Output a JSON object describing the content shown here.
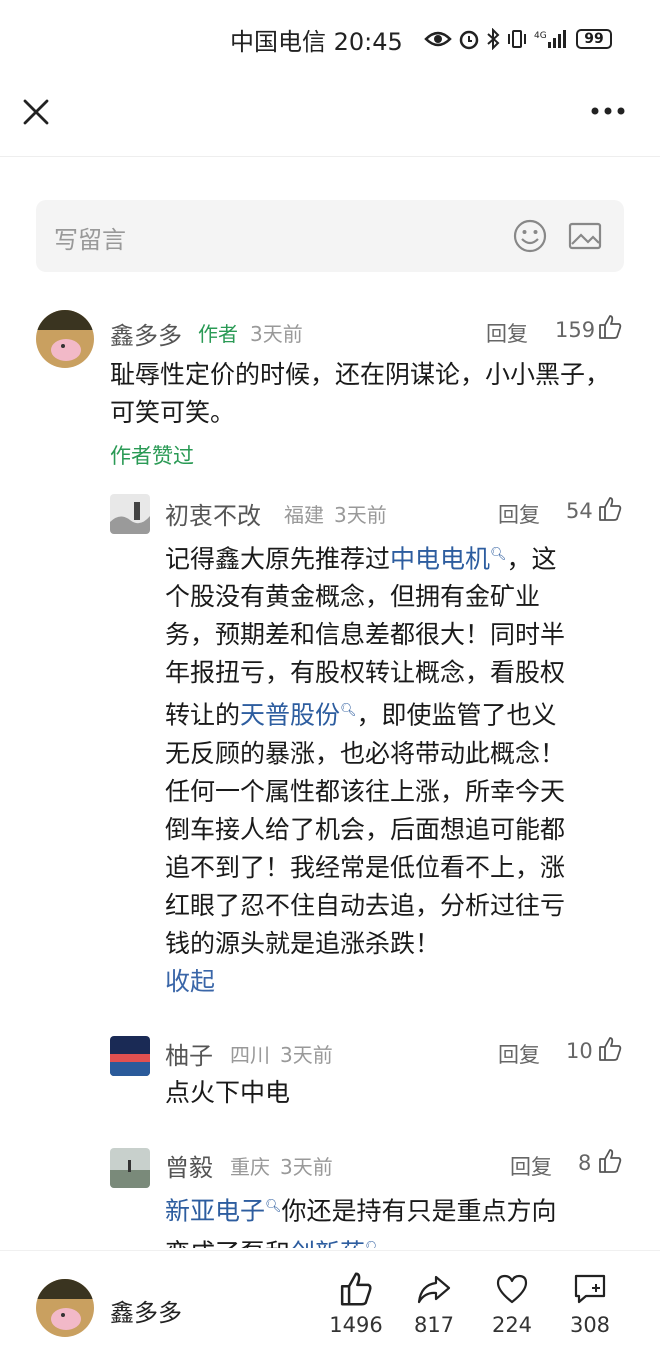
{
  "status": {
    "carrier_time": "中国电信 20:45",
    "battery": "99"
  },
  "header": {},
  "comment_input": {
    "placeholder": "写留言"
  },
  "comments": [
    {
      "name": "鑫多多",
      "tag": "作者",
      "time": "3天前",
      "reply": "回复",
      "likes": "159",
      "text": "耻辱性定价的时候，还在阴谋论，小小黑子，可笑可笑。",
      "author_liked": "作者赞过"
    }
  ],
  "replies": [
    {
      "name": "初衷不改",
      "location": "福建",
      "time": "3天前",
      "reply": "回复",
      "likes": "54",
      "lines": [
        {
          "pre": "记得鑫大原先推荐过",
          "link": "中电电机",
          "post": "，这"
        },
        {
          "pre": "个股没有黄金概念，但拥有金矿业"
        },
        {
          "pre": "务，预期差和信息差都很大！同时半"
        },
        {
          "pre": "年报扭亏，有股权转让概念，看股权"
        },
        {
          "pre": "转让的",
          "link": "天普股份",
          "post": "，即使监管了也义"
        },
        {
          "pre": "无反顾的暴涨，也必将带动此概念！"
        },
        {
          "pre": "任何一个属性都该往上涨，所幸今天"
        },
        {
          "pre": "倒车接人给了机会，后面想追可能都"
        },
        {
          "pre": "追不到了！我经常是低位看不上，涨"
        },
        {
          "pre": "红眼了忍不住自动去追，分析过往亏"
        },
        {
          "pre": "钱的源头就是追涨杀跌！"
        }
      ],
      "collapse": "收起"
    },
    {
      "name": "柚子",
      "location": "四川",
      "time": "3天前",
      "reply": "回复",
      "likes": "10",
      "text": "点火下中电"
    },
    {
      "name": "曾毅",
      "location": "重庆",
      "time": "3天前",
      "reply": "回复",
      "likes": "8",
      "line1": {
        "link": "新亚电子",
        "post": "你还是持有只是重点方向"
      },
      "line2": {
        "pre": "变成了泵和",
        "link": "创新药"
      }
    }
  ],
  "bottom": {
    "name": "鑫多多",
    "likes": "1496",
    "shares": "817",
    "favorites": "224",
    "comments": "308"
  }
}
